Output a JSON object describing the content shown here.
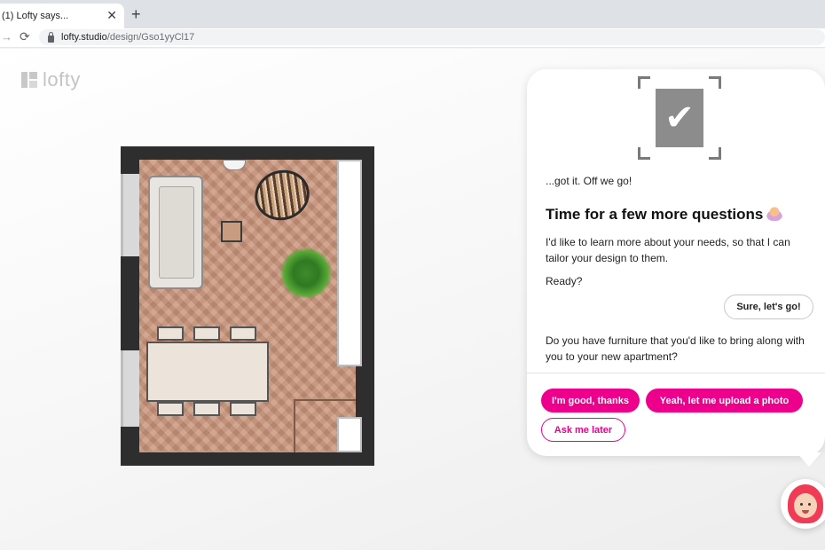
{
  "browser": {
    "tab_title": "(1) Lofty says...",
    "tab_close": "✕",
    "new_tab": "+",
    "url_host": "lofty.studio",
    "url_path": "/design/Gso1yyCl17"
  },
  "brand": {
    "logo_text": "lofty",
    "accent": "#ec008c"
  },
  "chat": {
    "ack": "...got it. Off we go!",
    "headline": "Time for a few more questions",
    "intro": "I'd like to learn more about your needs, so that I can tailor your design to them.",
    "ready": "Ready?",
    "user_reply": "Sure, let's go!",
    "question": "Do you have furniture that you'd like to bring along with you to your new apartment?",
    "options": [
      {
        "label": "I'm good, thanks"
      },
      {
        "label": "Yeah, let me upload a photo"
      },
      {
        "label": "Ask me later"
      }
    ]
  },
  "icons": {
    "check": "✔",
    "forward": "→",
    "reload": "⟳"
  }
}
